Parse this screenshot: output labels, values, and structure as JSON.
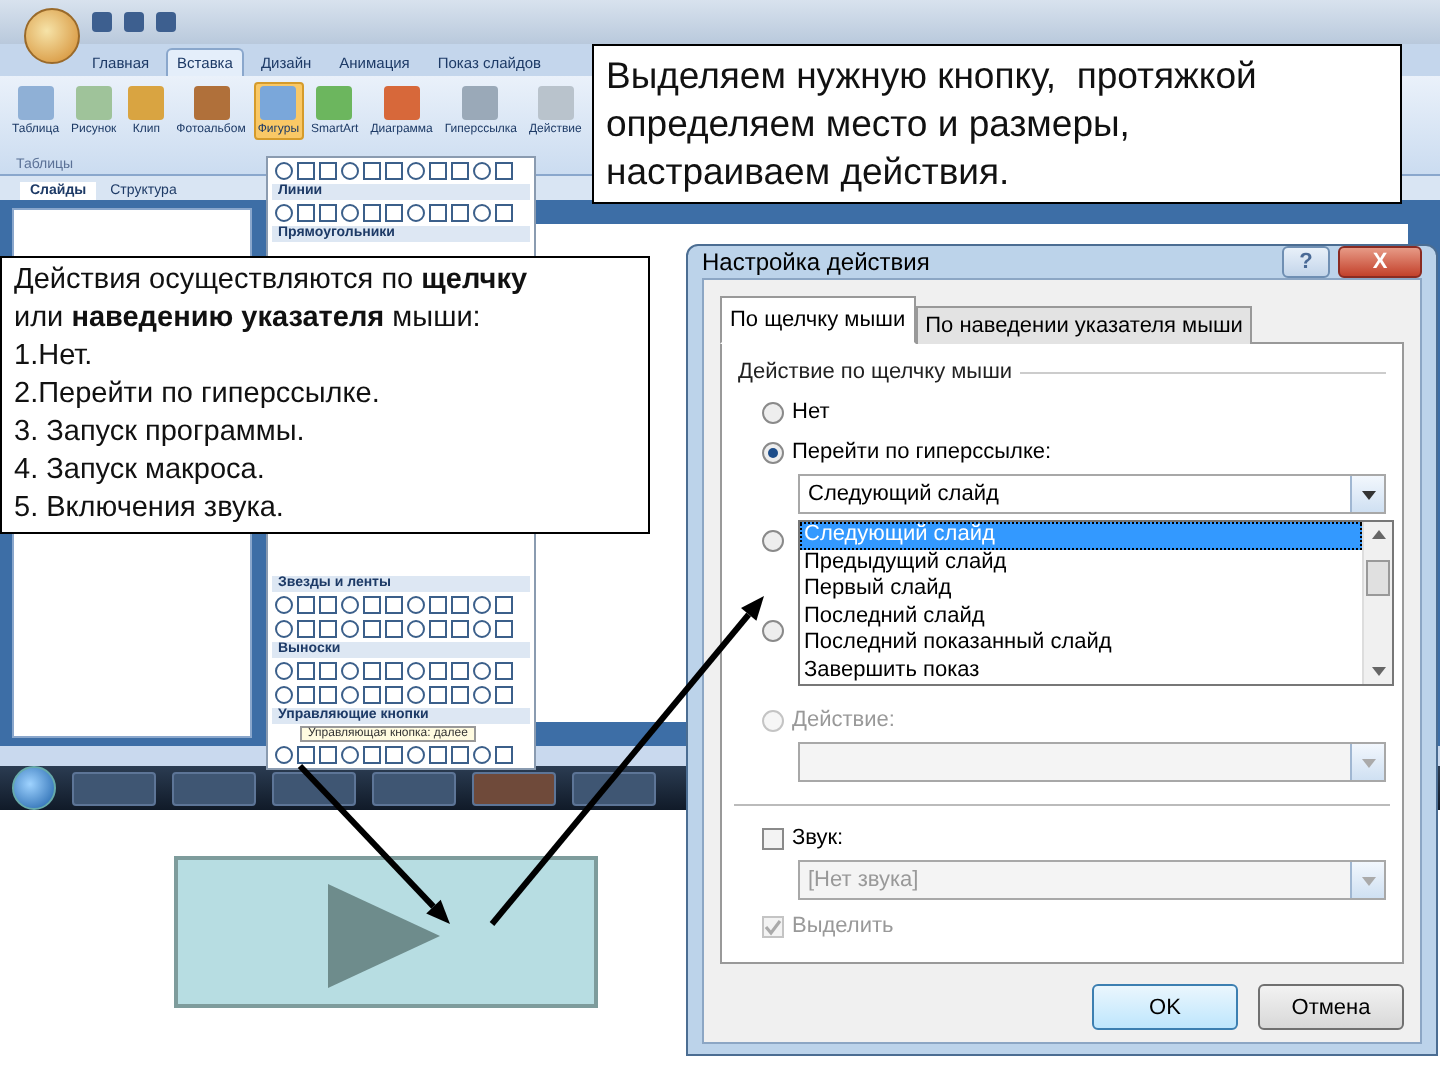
{
  "app": {
    "tabs": [
      {
        "label": "Главная",
        "selected": false
      },
      {
        "label": "Вставка",
        "selected": true
      },
      {
        "label": "Дизайн",
        "selected": false
      },
      {
        "label": "Анимация",
        "selected": false
      },
      {
        "label": "Показ слайдов",
        "selected": false
      }
    ],
    "ribbon_buttons": [
      {
        "label": "Таблица",
        "highlighted": false
      },
      {
        "label": "Рисунок",
        "highlighted": false
      },
      {
        "label": "Клип",
        "highlighted": false
      },
      {
        "label": "Фотоальбом",
        "highlighted": false
      },
      {
        "label": "Фигуры",
        "highlighted": true
      },
      {
        "label": "SmartArt",
        "highlighted": false
      },
      {
        "label": "Диаграмма",
        "highlighted": false
      },
      {
        "label": "Гиперссылка",
        "highlighted": false
      },
      {
        "label": "Действие",
        "highlighted": false
      }
    ],
    "ribbon_group": "Таблицы",
    "panel_tabs": [
      {
        "label": "Слайды",
        "selected": true
      },
      {
        "label": "Структура",
        "selected": false
      }
    ]
  },
  "shapes_gallery": {
    "sections": [
      {
        "label": "Линии"
      },
      {
        "label": "Прямоугольники"
      },
      {
        "label": "Звезды и ленты"
      },
      {
        "label": "Выноски"
      },
      {
        "label": "Управляющие кнопки"
      }
    ],
    "tooltip": "Управляющая кнопка: далее"
  },
  "callouts": [
    {
      "kind": "top",
      "lines": [
        "Выделяем нужную кнопку,  протяжкой",
        "определяем место и размеры,",
        "настраиваем действия."
      ]
    },
    {
      "kind": "left",
      "lines": [
        "Действия осуществляются по **щелчку**",
        "или **наведению указателя** мыши:",
        "1.Нет.",
        "2.Перейти по гиперссылке.",
        "3. Запуск программы.",
        "4. Запуск макроса.",
        "5. Включения звука."
      ]
    }
  ],
  "dialog": {
    "title": "Настройка действия",
    "help": "?",
    "close": "X",
    "tabs": [
      {
        "label": "По щелчку мыши",
        "selected": true
      },
      {
        "label": "По наведении указателя мыши",
        "selected": false
      }
    ],
    "group_label": "Действие по щелчку мыши",
    "options": [
      {
        "kind": "radio",
        "label": "Нет",
        "selected": false,
        "disabled": false
      },
      {
        "kind": "radio_dropdown",
        "label": "Перейти по гиперссылке:",
        "selected": true,
        "disabled": false,
        "dropdown": "Следующий слайд"
      },
      {
        "kind": "radio",
        "selected": false,
        "disabled": false
      },
      {
        "kind": "radio",
        "selected": false,
        "disabled": false
      },
      {
        "kind": "radio_dropdown",
        "label": "Действие:",
        "selected": false,
        "disabled": true
      }
    ],
    "open_list": [
      {
        "label": "Следующий слайд",
        "selected": true
      },
      {
        "label": "Предыдущий слайд",
        "selected": false
      },
      {
        "label": "Первый слайд",
        "selected": false
      },
      {
        "label": "Последний слайд",
        "selected": false
      },
      {
        "label": "Последний показанный слайд",
        "selected": false
      },
      {
        "label": "Завершить показ",
        "selected": false
      }
    ],
    "sound": {
      "label": "Звук:",
      "checked": false,
      "value": "[Нет звука]"
    },
    "highlight": {
      "label": "Выделить",
      "checked": true,
      "disabled": true
    },
    "buttons": [
      {
        "label": "OK",
        "default": true
      },
      {
        "label": "Отмена",
        "default": false
      }
    ]
  }
}
